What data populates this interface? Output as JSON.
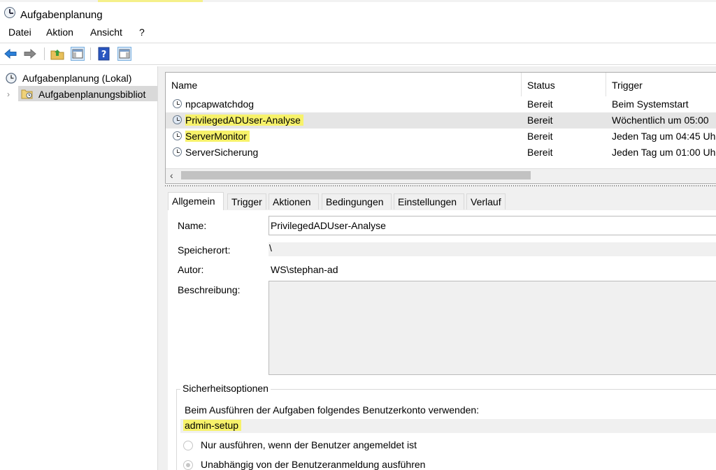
{
  "window": {
    "title": "Aufgabenplanung"
  },
  "menu": [
    "Datei",
    "Aktion",
    "Ansicht",
    "?"
  ],
  "tree": {
    "root": "Aufgabenplanung (Lokal)",
    "child": "Aufgabenplanungsbibliot"
  },
  "tasklist": {
    "columns": [
      "Name",
      "Status",
      "Trigger"
    ],
    "rows": [
      {
        "name": "npcapwatchdog",
        "status": "Bereit",
        "trigger": "Beim Systemstart"
      },
      {
        "name": "PrivilegedADUser-Analyse",
        "status": "Bereit",
        "trigger": "Wöchentlich um 05:00"
      },
      {
        "name": "ServerMonitor",
        "status": "Bereit",
        "trigger": "Jeden Tag um 04:45 Uh"
      },
      {
        "name": "ServerSicherung",
        "status": "Bereit",
        "trigger": "Jeden Tag um 01:00 Uh"
      }
    ],
    "selected_index": 1,
    "highlight_color": "#f7f26a"
  },
  "tabs": [
    "Allgemein",
    "Trigger",
    "Aktionen",
    "Bedingungen",
    "Einstellungen",
    "Verlauf"
  ],
  "general": {
    "name_label": "Name:",
    "name_value": "PrivilegedADUser-Analyse",
    "location_label": "Speicherort:",
    "location_value": "\\",
    "author_label": "Autor:",
    "author_value": "WS\\stephan-ad",
    "description_label": "Beschreibung:"
  },
  "security": {
    "title": "Sicherheitsoptionen",
    "account_text": "Beim Ausführen der Aufgaben folgendes Benutzerkonto verwenden:",
    "account_value": "admin-setup",
    "option1": "Nur ausführen, wenn der Benutzer angemeldet ist",
    "option2": "Unabhängig von der Benutzeranmeldung ausführen"
  },
  "icons": {
    "toolbar": [
      "back-arrow-icon",
      "forward-arrow-icon",
      "folder-up-icon",
      "show-hide-tree-icon",
      "help-icon",
      "action-pane-icon"
    ]
  }
}
